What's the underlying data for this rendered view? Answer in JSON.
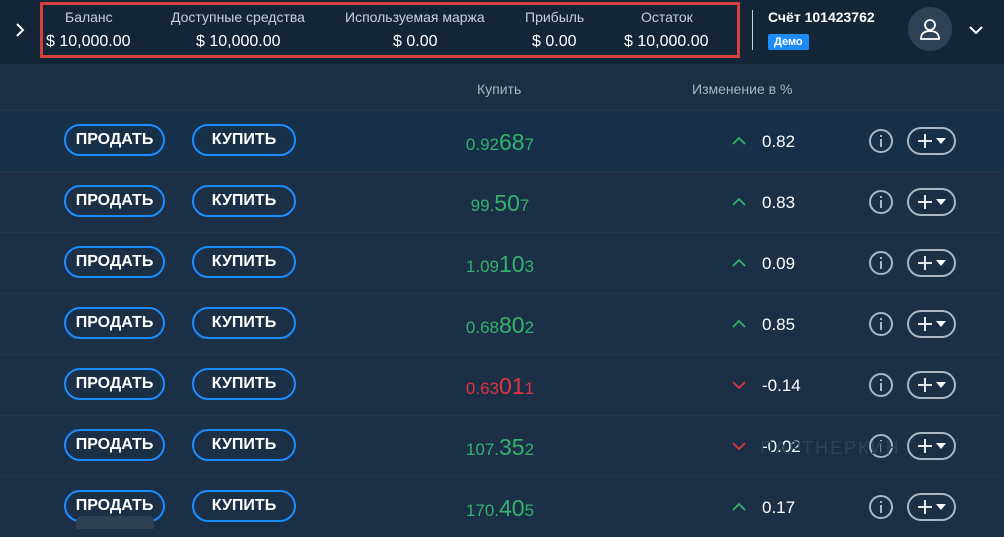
{
  "summary": {
    "balance_label": "Баланс",
    "balance_value": "$ 10,000.00",
    "available_label": "Доступные средства",
    "available_value": "$ 10,000.00",
    "margin_label": "Используемая маржа",
    "margin_value": "$ 0.00",
    "profit_label": "Прибыль",
    "profit_value": "$ 0.00",
    "remainder_label": "Остаток",
    "remainder_value": "$ 10,000.00"
  },
  "account": {
    "title": "Счёт 101423762",
    "badge": "Демо"
  },
  "columns": {
    "buy": "Купить",
    "change": "Изменение в %"
  },
  "buttons": {
    "sell": "ПРОДАТЬ",
    "buy": "КУПИТЬ"
  },
  "rows": [
    {
      "price_prefix": "0.92",
      "price_big": "68",
      "price_suffix": "7",
      "direction": "up",
      "change": "0.82"
    },
    {
      "price_prefix": "99.",
      "price_big": "50",
      "price_suffix": "7",
      "direction": "up",
      "change": "0.83"
    },
    {
      "price_prefix": "1.09",
      "price_big": "10",
      "price_suffix": "3",
      "direction": "up",
      "change": "0.09"
    },
    {
      "price_prefix": "0.68",
      "price_big": "80",
      "price_suffix": "2",
      "direction": "up",
      "change": "0.85"
    },
    {
      "price_prefix": "0.63",
      "price_big": "01",
      "price_suffix": "1",
      "direction": "down",
      "change": "-0.14"
    },
    {
      "price_prefix": "107.",
      "price_big": "35",
      "price_suffix": "2",
      "direction": "up",
      "change": "-0.02",
      "arrow": "down"
    },
    {
      "price_prefix": "170.",
      "price_big": "40",
      "price_suffix": "5",
      "direction": "up",
      "change": "0.17"
    }
  ],
  "watermark": "ПАРТНЕРКИН",
  "colors": {
    "accent": "#1a8cff",
    "up": "#33b26b",
    "down": "#e2323f",
    "highlight_border": "#d6403a",
    "demo_badge": "#1d8cf8"
  }
}
